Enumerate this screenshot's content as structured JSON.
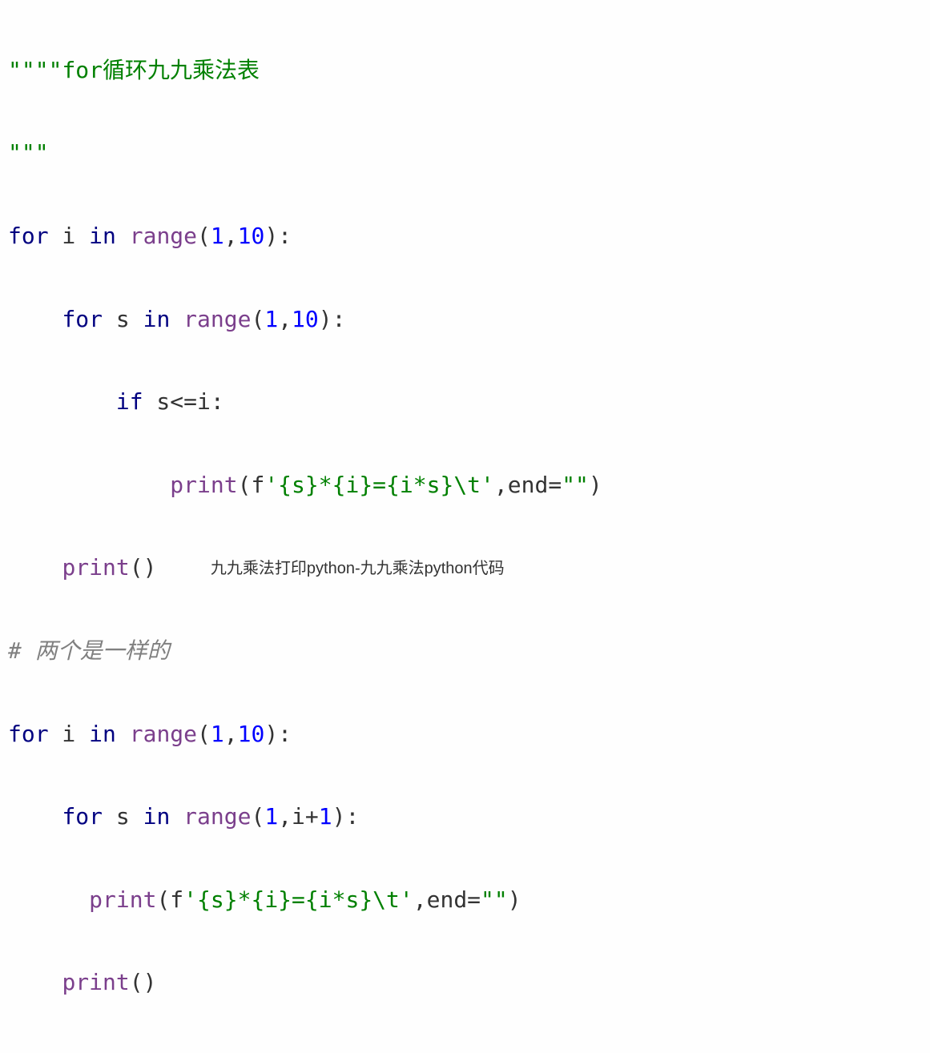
{
  "code": {
    "l1": {
      "q": "\"\"\"\"",
      "s": "for循环九九乘法表"
    },
    "l2": {
      "q": "\"\"\""
    },
    "l3": {
      "kw1": "for",
      "id1": " i ",
      "kw2": "in",
      "sp": " ",
      "fn": "range",
      "args": "(",
      "n1": "1",
      "c": ",",
      "n2": "10",
      "end": "):"
    },
    "l4": {
      "kw1": "for",
      "id1": " s ",
      "kw2": "in",
      "sp": " ",
      "fn": "range",
      "args": "(",
      "n1": "1",
      "c": ",",
      "n2": "10",
      "end": "):"
    },
    "l5": {
      "kw": "if",
      "cond": " s<=i:"
    },
    "l6": {
      "fn": "print",
      "open": "(f",
      "s": "'{s}*{i}={i*s}\\t'",
      "mid": ",end=",
      "s2": "\"\"",
      "close": ")"
    },
    "l7": {
      "fn": "print",
      "paren": "()"
    },
    "l8": {
      "hash": "# ",
      "txt": "两个是一样的"
    },
    "l9": {
      "kw1": "for",
      "id1": " i ",
      "kw2": "in",
      "sp": " ",
      "fn": "range",
      "args": "(",
      "n1": "1",
      "c": ",",
      "n2": "10",
      "end": "):"
    },
    "l10": {
      "kw1": "for",
      "id1": " s ",
      "kw2": "in",
      "sp": " ",
      "fn": "range",
      "args": "(",
      "n1": "1",
      "c": ",",
      "expr": "i+",
      "n2": "1",
      "end": "):"
    },
    "l11": {
      "fn": "print",
      "open": "(f",
      "s": "'{s}*{i}={i*s}\\t'",
      "mid": ",end=",
      "s2": "\"\"",
      "close": ")"
    },
    "l12": {
      "fn": "print",
      "paren": "()"
    }
  },
  "watermark": "九九乘法打印python-九九乘法python代码"
}
